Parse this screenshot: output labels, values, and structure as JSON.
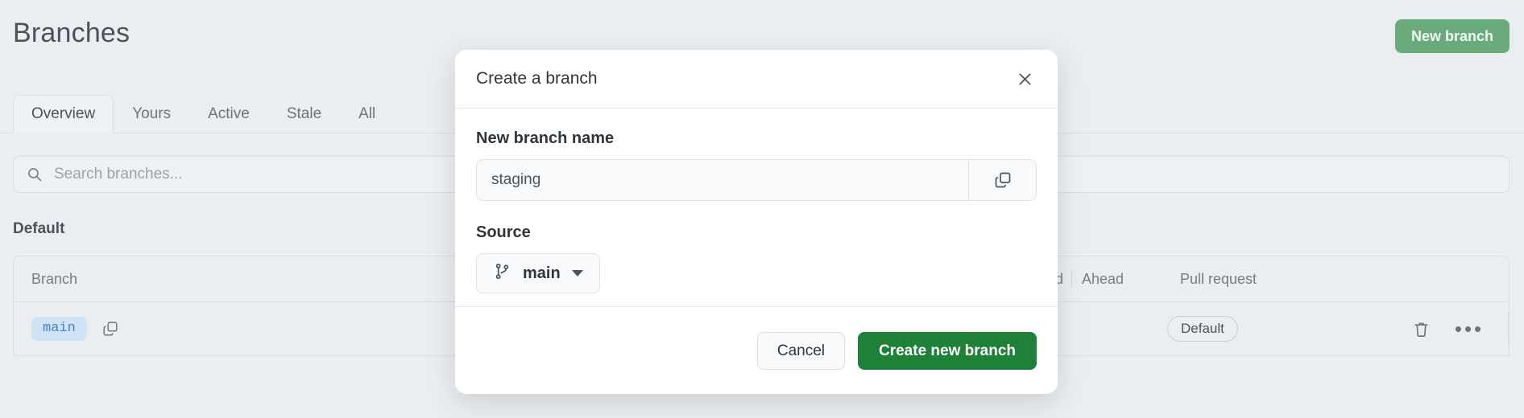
{
  "page": {
    "title": "Branches",
    "new_branch_label": "New branch"
  },
  "tabs": [
    {
      "label": "Overview",
      "active": true
    },
    {
      "label": "Yours",
      "active": false
    },
    {
      "label": "Active",
      "active": false
    },
    {
      "label": "Stale",
      "active": false
    },
    {
      "label": "All",
      "active": false
    }
  ],
  "search": {
    "placeholder": "Search branches...",
    "value": "",
    "icon": "search-icon"
  },
  "section": {
    "label": "Default"
  },
  "table": {
    "columns": {
      "branch": "Branch",
      "behind": "Behind",
      "ahead": "Ahead",
      "pull_request": "Pull request"
    },
    "rows": [
      {
        "branch": "main",
        "behind": "",
        "ahead": "",
        "pull_request": "Default",
        "copy_icon": "copy-icon",
        "delete_icon": "trash-icon",
        "more_icon": "ellipsis-icon"
      }
    ]
  },
  "modal": {
    "title": "Create a branch",
    "close_icon": "close-icon",
    "name_field": {
      "label": "New branch name",
      "value": "staging",
      "placeholder": "",
      "copy_icon": "copy-icon"
    },
    "source_field": {
      "label": "Source",
      "value": "main",
      "branch_icon": "git-branch-icon",
      "caret_icon": "chevron-down-icon"
    },
    "cancel_label": "Cancel",
    "create_label": "Create new branch"
  },
  "colors": {
    "page_background": "#eaeef0",
    "primary_green": "#1f8038",
    "new_branch_green": "#6aab7c",
    "branch_pill_background": "#cfe3f5",
    "branch_pill_text": "#4a7fc1",
    "border": "#d8dee2",
    "text_primary": "#2e353c",
    "text_muted": "#737c86"
  }
}
